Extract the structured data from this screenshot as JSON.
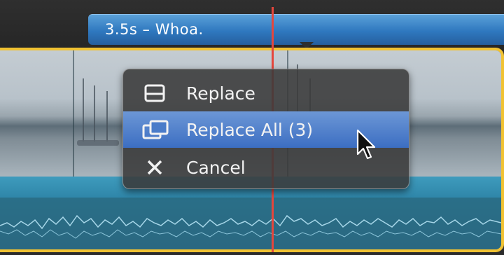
{
  "title_clip": {
    "label": "3.5s – Whoa."
  },
  "menu": {
    "items": [
      {
        "label": "Replace",
        "icon": "replace-icon"
      },
      {
        "label": "Replace All (3)",
        "icon": "replace-all-icon",
        "highlighted": true
      },
      {
        "label": "Cancel",
        "icon": "cancel-icon"
      }
    ]
  },
  "colors": {
    "title_clip": "#2f78bf",
    "selection_border": "#f1c232",
    "menu_highlight": "#4a7cc9",
    "playhead": "#e5463c",
    "audio": "#2f86a9"
  }
}
